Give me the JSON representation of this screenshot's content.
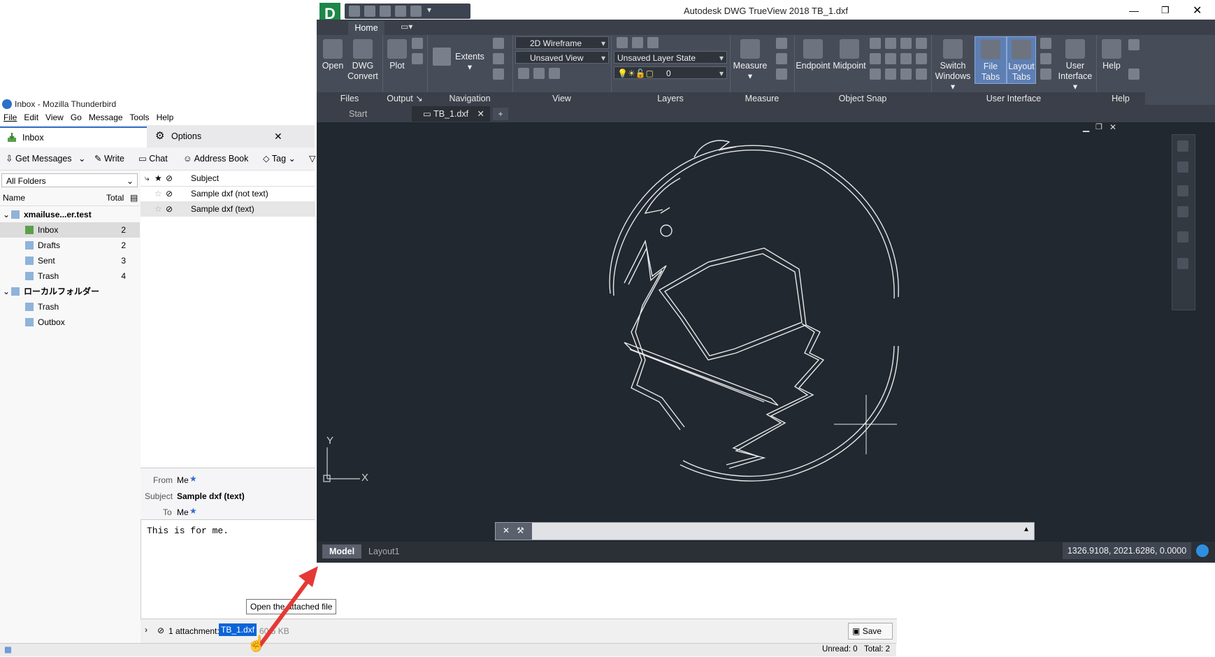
{
  "thunderbird": {
    "window_title": "Inbox - Mozilla Thunderbird",
    "menu": [
      "File",
      "Edit",
      "View",
      "Go",
      "Message",
      "Tools",
      "Help"
    ],
    "tabs": [
      {
        "label": "Inbox",
        "icon": "inbox-icon"
      },
      {
        "label": "Options",
        "icon": "gear-icon"
      }
    ],
    "toolbar": {
      "get_messages": "Get Messages",
      "write": "Write",
      "chat": "Chat",
      "address_book": "Address Book",
      "tag": "Tag"
    },
    "folder_pane": {
      "selector": "All Folders",
      "col_name": "Name",
      "col_total": "Total",
      "folders": [
        {
          "name": "xmailuse...er.test",
          "count": "",
          "level": 0,
          "icon": "mail-account-icon"
        },
        {
          "name": "Inbox",
          "count": "2",
          "level": 1,
          "icon": "inbox-icon",
          "selected": true
        },
        {
          "name": "Drafts",
          "count": "2",
          "level": 1,
          "icon": "drafts-icon"
        },
        {
          "name": "Sent",
          "count": "3",
          "level": 1,
          "icon": "sent-icon"
        },
        {
          "name": "Trash",
          "count": "4",
          "level": 1,
          "icon": "trash-icon"
        },
        {
          "name": "ローカルフォルダー",
          "count": "",
          "level": 0,
          "icon": "local-folders-icon"
        },
        {
          "name": "Trash",
          "count": "",
          "level": 1,
          "icon": "trash-icon"
        },
        {
          "name": "Outbox",
          "count": "",
          "level": 1,
          "icon": "outbox-icon"
        }
      ]
    },
    "message_list": {
      "col_subject": "Subject",
      "messages": [
        {
          "subject": "Sample dxf (not text)",
          "selected": false
        },
        {
          "subject": "Sample dxf (text)",
          "selected": true
        }
      ]
    },
    "message_header": {
      "from_label": "From",
      "from_value": "Me",
      "subject_label": "Subject",
      "subject_value": "Sample dxf (text)",
      "to_label": "To",
      "to_value": "Me"
    },
    "body": "This is for me.",
    "attachment": {
      "count_label": "1 attachment:",
      "filename": "TB_1.dxf",
      "size": "60.5 KB",
      "save_label": "Save",
      "tooltip": "Open the attached file"
    },
    "status": {
      "unread": "Unread: 0",
      "total": "Total: 2"
    }
  },
  "autocad": {
    "window_title": "Autodesk DWG TrueView 2018    TB_1.dxf",
    "ribbon_tabs": [
      "Home"
    ],
    "panels": {
      "files": "Files",
      "output": "Output",
      "navigation": "Navigation",
      "view": "View",
      "layers": "Layers",
      "measure": "Measure",
      "object_snap": "Object Snap",
      "user_interface": "User Interface",
      "help": "Help"
    },
    "buttons": {
      "open": "Open",
      "dwg_convert_1": "DWG",
      "dwg_convert_2": "Convert",
      "plot": "Plot",
      "extents": "Extents",
      "measure": "Measure",
      "endpoint": "Endpoint",
      "midpoint": "Midpoint",
      "switch_windows_1": "Switch",
      "switch_windows_2": "Windows",
      "file_tabs": "File Tabs",
      "layout_tabs_1": "Layout",
      "layout_tabs_2": "Tabs",
      "user_interface_1": "User",
      "user_interface_2": "Interface",
      "help": "Help"
    },
    "dropdowns": {
      "visual_style": "2D Wireframe",
      "named_view": "Unsaved View",
      "layer_state": "Unsaved Layer State",
      "layer": "0"
    },
    "file_tabs": [
      "Start",
      "TB_1.dxf"
    ],
    "layout_tabs": [
      "Model",
      "Layout1"
    ],
    "coordinates": "1326.9108, 2021.6286, 0.0000",
    "ucs": {
      "x_label": "X",
      "y_label": "Y"
    }
  },
  "colors": {
    "thunderbird_accent": "#2e6fc9",
    "acad_canvas": "#212830",
    "acad_ribbon": "#464c58",
    "selection_blue": "#0a64d8",
    "arrow_red": "#e53935"
  }
}
